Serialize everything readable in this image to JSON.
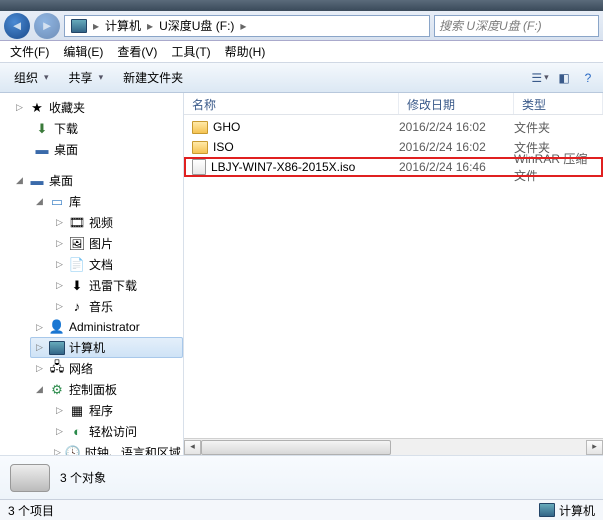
{
  "address": {
    "segments": [
      "计算机",
      "U深度U盘 (F:)"
    ],
    "search_placeholder": "搜索 U深度U盘 (F:)"
  },
  "menu": {
    "file": "文件(F)",
    "edit": "编辑(E)",
    "view": "查看(V)",
    "tools": "工具(T)",
    "help": "帮助(H)"
  },
  "toolbar": {
    "organize": "组织",
    "share": "共享",
    "newfolder": "新建文件夹"
  },
  "tree": {
    "favorites": "收藏夹",
    "downloads": "下载",
    "desktop": "桌面",
    "desktop2": "桌面",
    "libraries": "库",
    "videos": "视频",
    "pictures": "图片",
    "documents": "文档",
    "xunlei": "迅雷下载",
    "music": "音乐",
    "admin": "Administrator",
    "computer": "计算机",
    "network": "网络",
    "controlpanel": "控制面板",
    "programs": "程序",
    "ease": "轻松访问",
    "clock": "时钟、语言和区域"
  },
  "columns": {
    "name": "名称",
    "date": "修改日期",
    "type": "类型"
  },
  "files": [
    {
      "name": "GHO",
      "date": "2016/2/24 16:02",
      "type": "文件夹",
      "icon": "folder"
    },
    {
      "name": "ISO",
      "date": "2016/2/24 16:02",
      "type": "文件夹",
      "icon": "folder"
    },
    {
      "name": "LBJY-WIN7-X86-2015X.iso",
      "date": "2016/2/24 16:46",
      "type": "WinRAR 压缩文件",
      "icon": "file",
      "highlight": true
    }
  ],
  "details": {
    "count": "3 个对象"
  },
  "status": {
    "left": "3 个项目",
    "right": "计算机"
  }
}
